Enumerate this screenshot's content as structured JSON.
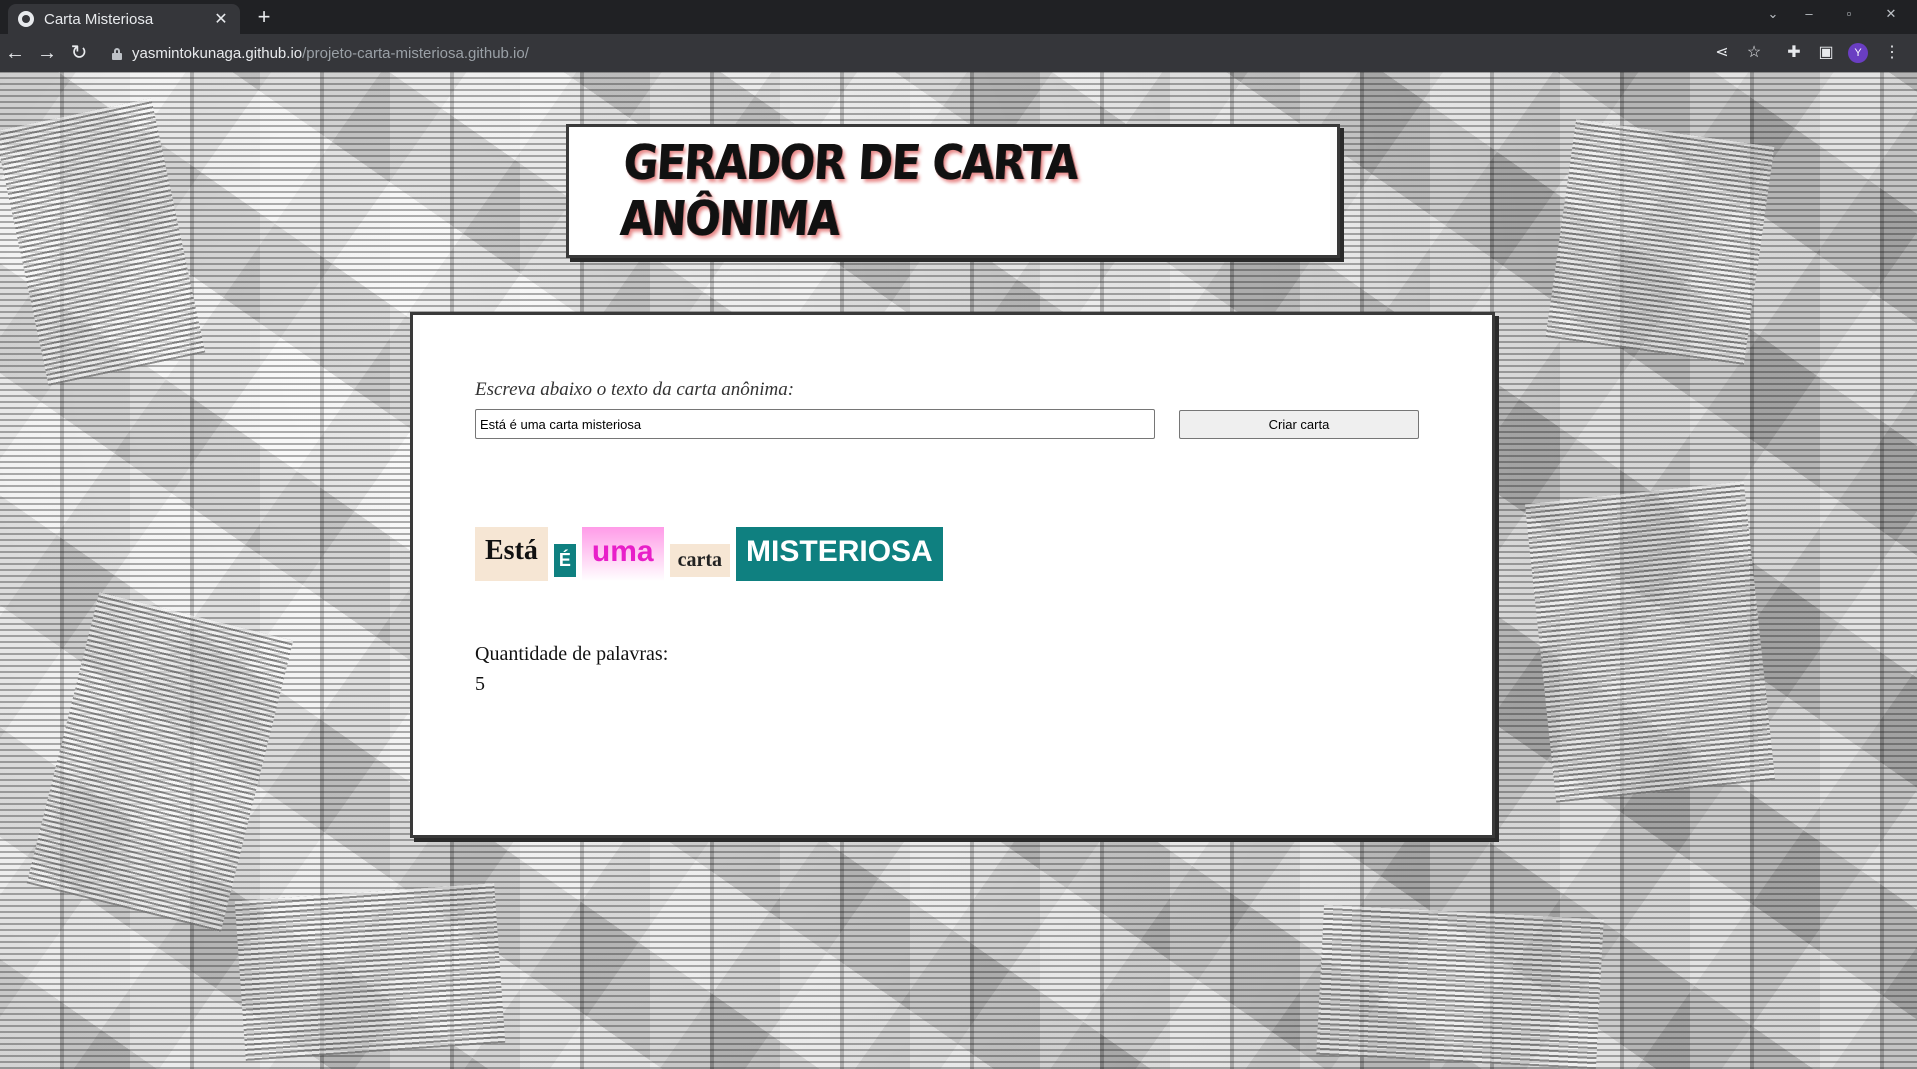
{
  "browser": {
    "tab_title": "Carta Misteriosa",
    "tab_close": "✕",
    "new_tab": "+",
    "url_host": "yasmintokunaga.github.io",
    "url_path": "/projeto-carta-misteriosa.github.io/",
    "profile_initial": "Y",
    "icons": {
      "back": "back-arrow-icon",
      "forward": "forward-arrow-icon",
      "reload": "reload-icon",
      "share": "share-icon",
      "bookmark": "star-icon",
      "extensions": "puzzle-icon",
      "sidepanel": "side-panel-icon",
      "menu": "kebab-menu-icon"
    }
  },
  "page": {
    "heading": "GERADOR DE CARTA ANÔNIMA",
    "input_label": "Escreva abaixo o texto da carta anônima:",
    "input_value": "Está é uma carta misteriosa",
    "button_label": "Criar carta",
    "letter_words": [
      "Está",
      "É",
      "uma",
      "carta",
      "MISTERIOSA"
    ],
    "count_label": "Quantidade de palavras:",
    "count_value": "5"
  },
  "colors": {
    "teal": "#0f8080",
    "beige": "#f6e6d4",
    "magenta": "#e81fc9",
    "title_shadow": "#e88a8a"
  }
}
